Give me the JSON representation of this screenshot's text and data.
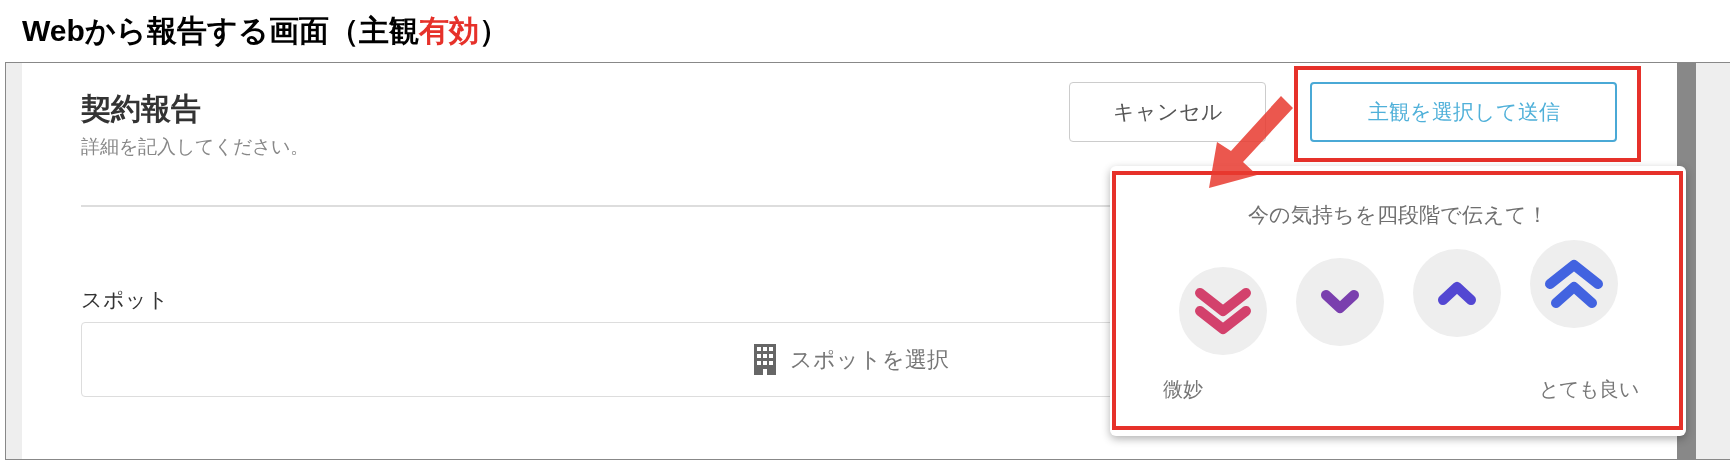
{
  "page_title": [
    {
      "text": "Webから報告する画面（主観",
      "emphasis": false
    },
    {
      "text": "有効",
      "emphasis": true
    },
    {
      "text": "）",
      "emphasis": false
    }
  ],
  "form": {
    "title": "契約報告",
    "subtitle": "詳細を記入してください。",
    "buttons": [
      {
        "label": "キャンセル",
        "kind": "secondary"
      },
      {
        "label": "主観を選択して送信",
        "kind": "primary"
      }
    ],
    "fields": [
      {
        "label": "スポット",
        "placeholder": "スポットを選択"
      }
    ]
  },
  "mood_popup": {
    "prompt": "今の気持ちを四段階で伝えて！",
    "options": [
      {
        "kind": "double_down",
        "color": "#d3416c"
      },
      {
        "kind": "down",
        "color": "#7a3fae"
      },
      {
        "kind": "up",
        "color": "#5347d2"
      },
      {
        "kind": "double_up",
        "color": "#4263e0"
      }
    ],
    "low_label": "微妙",
    "high_label": "とても良い"
  }
}
